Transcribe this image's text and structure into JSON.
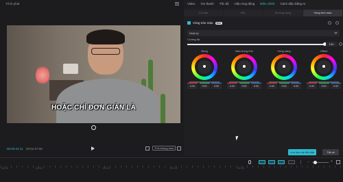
{
  "player": {
    "title": "Trình phát",
    "caption": "HOẶC CHỈ ĐƠN GIẢN LÀ",
    "time_current": "00:00:22:11",
    "time_total": "00:01:07:08",
    "aspect_ratio": "Tỉ lệ khung hình"
  },
  "inspector": {
    "tabs": [
      "Video",
      "Âm thanh",
      "Tốc độ",
      "Hiệu ứng động",
      "Điều chỉnh",
      "Cách điệu bằng AI"
    ],
    "active_tab": "Điều chỉnh",
    "sub_tabs": [
      "Cơ bản",
      "HSL",
      "Đường cong",
      "Vòng tròn màu"
    ],
    "active_sub_tab": "Vòng tròn màu",
    "section_title": "Vòng tròn màu",
    "section_badge": "Mới",
    "mode": "Nhật ký",
    "strength_label": "Cường độ",
    "strength_value": "100",
    "strength_fraction": 1.0,
    "wheels": [
      {
        "label": "Bóng",
        "r": "0.00",
        "g": "0.00",
        "b": "0.00"
      },
      {
        "label": "Màu trung tính",
        "r": "0.00",
        "g": "0.00",
        "b": "0.00"
      },
      {
        "label": "Vùng sáng",
        "r": "0.00",
        "g": "0.00",
        "b": "0.00"
      },
      {
        "label": "Offset",
        "r": "0.00",
        "g": "0.00",
        "b": "0.00"
      }
    ],
    "save_button": "Lưu làm cài đặt sẵn",
    "apply_button": "Tất cả"
  },
  "timeline": {
    "ruler_labels": [
      "00:00",
      "00:05",
      "00:10",
      "00:15",
      "00:20"
    ]
  },
  "colors": {
    "accent": "#2fbad0",
    "background": "#1b1b1e",
    "panel": "#1f1f22"
  }
}
